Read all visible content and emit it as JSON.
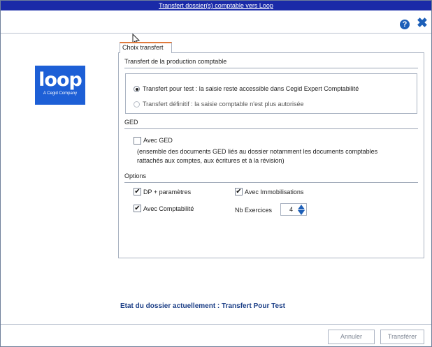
{
  "window": {
    "title": "Transfert dossier(s) comptable vers Loop"
  },
  "header": {
    "help_icon": "question-circle-icon",
    "help_glyph": "?",
    "close_icon": "close-x-icon",
    "close_glyph": "✖"
  },
  "logo": {
    "word": "loop",
    "subtitle": "A Cegid Company",
    "bg_color": "#1d5fd6"
  },
  "tab": {
    "label": "Choix transfert"
  },
  "transfer_section": {
    "title": "Transfert de la production comptable",
    "options": [
      {
        "label": "Transfert pour test : la saisie reste accessible dans Cegid Expert Comptabilité",
        "selected": true
      },
      {
        "label": "Transfert définitif : la saisie comptable n'est plus autorisée",
        "selected": false
      }
    ]
  },
  "ged_section": {
    "title": "GED",
    "checkbox_label": "Avec GED",
    "checked": false,
    "note_line1": "(ensemble des documents GED liés au dossier notamment les documents comptables",
    "note_line2": "rattachés aux comptes, aux écritures et à la révision)"
  },
  "options_section": {
    "title": "Options",
    "dp_label": "DP + paramètres",
    "dp_checked": true,
    "immo_label": "Avec Immobilisations",
    "immo_checked": true,
    "compta_label": "Avec Comptabilité",
    "compta_checked": true,
    "nb_exercices_label": "Nb Exercices",
    "nb_exercices_value": "4"
  },
  "status": {
    "text": "Etat du dossier actuellement : Transfert Pour Test",
    "color": "#1b3e86"
  },
  "footer": {
    "cancel_label": "Annuler",
    "transfer_label": "Transférer"
  },
  "colors": {
    "titlebar": "#1a2aa8",
    "accent_tab": "#e07a3c",
    "icon_blue": "#1d5fb8"
  }
}
